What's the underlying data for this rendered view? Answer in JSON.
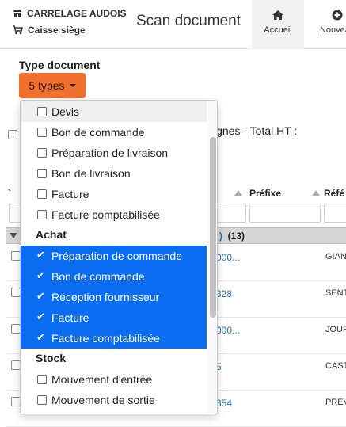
{
  "header": {
    "company": "CARRELAGE AUDOIS",
    "register": "Caisse siège",
    "title": "Scan document",
    "tabs": [
      {
        "label": "Accueil",
        "icon": "home-icon",
        "active": true
      },
      {
        "label": "Nouveau",
        "icon": "plus-circle-icon",
        "active": false
      }
    ]
  },
  "filter": {
    "type_label": "Type document",
    "types_button": "5 types"
  },
  "background": {
    "lignes_text": "ignes - Total HT :",
    "col_prefix": "Préfixe",
    "col_ref": "Réfé",
    "col_first": "`",
    "group_label": ")",
    "group_count": "(13)",
    "rows": [
      {
        "link": "000...",
        "name": "GIAN"
      },
      {
        "link": "328",
        "name": "SENT"
      },
      {
        "link": "000...",
        "name": "JOUR"
      },
      {
        "link": "5",
        "name": "CAST"
      },
      {
        "link": "354",
        "name": "PREV"
      }
    ]
  },
  "dropdown": {
    "items": [
      {
        "label": "Devis",
        "checked": false
      },
      {
        "label": "Bon de commande",
        "checked": false
      },
      {
        "label": "Préparation de livraison",
        "checked": false
      },
      {
        "label": "Bon de livraison",
        "checked": false
      },
      {
        "label": "Facture",
        "checked": false
      },
      {
        "label": "Facture comptabilisée",
        "checked": false
      }
    ],
    "groups": [
      {
        "label": "Achat",
        "items": [
          {
            "label": "Préparation de commande",
            "checked": true
          },
          {
            "label": "Bon de commande",
            "checked": true
          },
          {
            "label": "Réception fournisseur",
            "checked": true
          },
          {
            "label": "Facture",
            "checked": true
          },
          {
            "label": "Facture comptabilisée",
            "checked": true
          }
        ]
      },
      {
        "label": "Stock",
        "items": [
          {
            "label": "Mouvement d'entrée",
            "checked": false
          },
          {
            "label": "Mouvement de sortie",
            "checked": false
          }
        ]
      }
    ]
  },
  "colors": {
    "accent_orange": "#f36f2e",
    "selected_blue": "#0a6cf0",
    "link_blue": "#2a6fb5"
  }
}
